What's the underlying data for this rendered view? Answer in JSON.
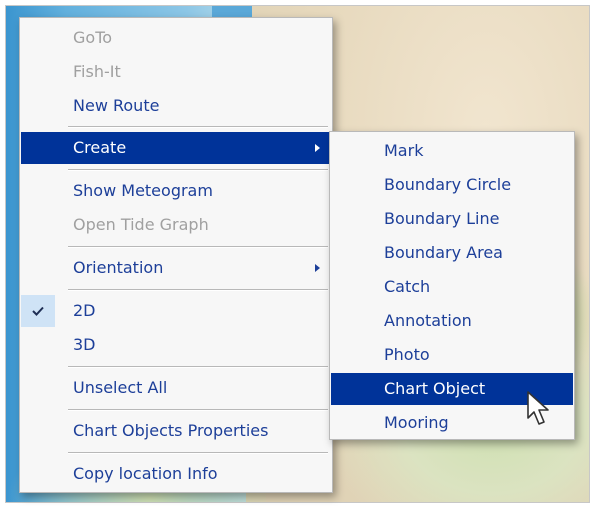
{
  "main_menu": {
    "items": [
      {
        "label": "GoTo",
        "enabled": false
      },
      {
        "label": "Fish-It",
        "enabled": false
      },
      {
        "label": "New Route",
        "enabled": true
      },
      {
        "label": "Create",
        "enabled": true,
        "submenu": true,
        "highlighted": true
      },
      {
        "label": "Show Meteogram",
        "enabled": true
      },
      {
        "label": "Open Tide Graph",
        "enabled": false
      },
      {
        "label": "Orientation",
        "enabled": true,
        "submenu": true
      },
      {
        "label": "2D",
        "enabled": true,
        "checked": true
      },
      {
        "label": "3D",
        "enabled": true
      },
      {
        "label": "Unselect All",
        "enabled": true
      },
      {
        "label": "Chart Objects Properties",
        "enabled": true
      },
      {
        "label": "Copy location Info",
        "enabled": true
      }
    ]
  },
  "create_submenu": {
    "items": [
      {
        "label": "Mark"
      },
      {
        "label": "Boundary Circle"
      },
      {
        "label": "Boundary Line"
      },
      {
        "label": "Boundary Area"
      },
      {
        "label": "Catch"
      },
      {
        "label": "Annotation"
      },
      {
        "label": "Photo"
      },
      {
        "label": "Chart Object",
        "highlighted": true
      },
      {
        "label": "Mooring"
      }
    ]
  },
  "colors": {
    "highlight": "#003399",
    "enabled_text": "#1d3f99",
    "disabled_text": "#a0a0a0",
    "check_background": "#cfe3f6"
  },
  "icons": {
    "check": "check-icon",
    "submenu_arrow": "chevron-right-icon",
    "cursor": "mouse-pointer-icon"
  }
}
